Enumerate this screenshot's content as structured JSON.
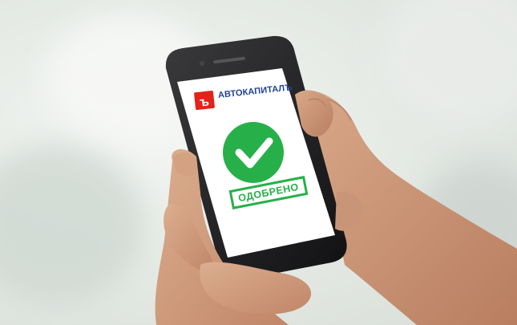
{
  "app": {
    "brand": "АВТОКАПИТАЛЪ",
    "status": "ОДОБРЕНО"
  },
  "icons": {
    "logo": "logo-icon",
    "approved": "checkmark-circle-icon"
  },
  "colors": {
    "brand_red": "#e2231a",
    "brand_blue": "#1f3f95",
    "approved_green": "#27b04a"
  }
}
